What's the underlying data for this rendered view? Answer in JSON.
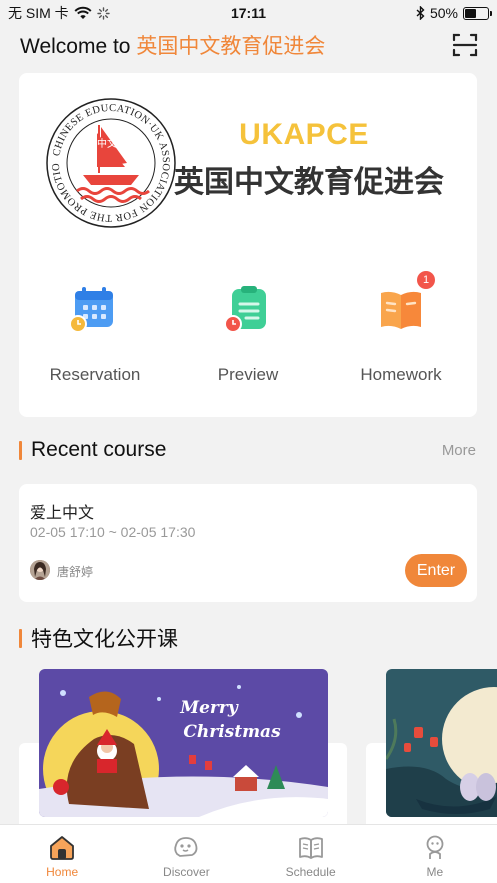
{
  "status": {
    "carrier": "无 SIM 卡",
    "time": "17:11",
    "battery": "50%",
    "battery_level": 0.5
  },
  "header": {
    "welcome_prefix": "Welcome to ",
    "org_name": "英国中文教育促进会"
  },
  "hero": {
    "brand_en": "UKAPCE",
    "brand_cn": "英国中文教育促进会",
    "logo_ring_text": "CHINESE EDUCATION·UK ASSOCIATION FOR THE PROMOTION OF",
    "logo_sail_text": "中文"
  },
  "quick_actions": [
    {
      "label": "Reservation",
      "icon": "calendar-icon",
      "badge": ""
    },
    {
      "label": "Preview",
      "icon": "clipboard-icon",
      "badge": ""
    },
    {
      "label": "Homework",
      "icon": "book-icon",
      "badge": "1"
    }
  ],
  "recent": {
    "title": "Recent course",
    "more": "More",
    "course": {
      "name": "爱上中文",
      "time": "02-05 17:10 ~ 02-05 17:30",
      "teacher": "唐舒婷",
      "enter": "Enter"
    }
  },
  "culture": {
    "title": "特色文化公开课",
    "cards": [
      {
        "image_text_1": "Merry",
        "image_text_2": "Christmas"
      },
      {
        "image_text_1": "",
        "image_text_2": ""
      }
    ]
  },
  "tabs": [
    {
      "label": "Home",
      "icon": "home-icon",
      "active": true
    },
    {
      "label": "Discover",
      "icon": "discover-icon",
      "active": false
    },
    {
      "label": "Schedule",
      "icon": "schedule-book-icon",
      "active": false
    },
    {
      "label": "Me",
      "icon": "person-icon",
      "active": false
    }
  ],
  "colors": {
    "accent": "#f0873a",
    "brand_yellow": "#f5c23b",
    "logo_red": "#e8453c",
    "badge": "#f2554a"
  }
}
